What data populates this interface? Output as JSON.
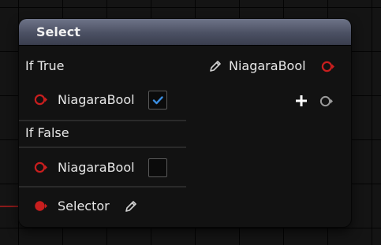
{
  "node": {
    "title": "Select",
    "output": {
      "label": "NiagaraBool",
      "pencil_icon": "pencil-icon",
      "pin_color": "#c81e1e"
    },
    "if_true": {
      "section_label": "If True",
      "input_label": "NiagaraBool",
      "checked": true
    },
    "if_false": {
      "section_label": "If False",
      "input_label": "NiagaraBool",
      "checked": false
    },
    "add_pin": {
      "icon": "plus-icon"
    },
    "selector": {
      "label": "Selector",
      "pencil_icon": "pencil-icon",
      "pin_color": "#c81e1e"
    }
  },
  "colors": {
    "pin_red": "#c81e1e",
    "checkbox_blue": "#3a8de0",
    "header_top": "#6e7488",
    "header_bottom": "#3a3e4e"
  }
}
